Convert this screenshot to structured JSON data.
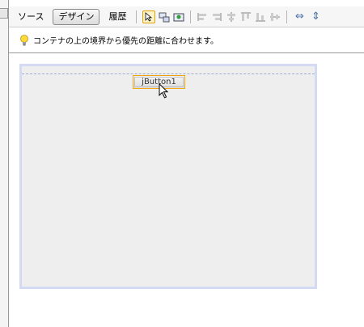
{
  "toolbar": {
    "source_tab": "ソース",
    "design_tab": "デザイン",
    "history_tab": "履歴",
    "icons": [
      "selection-mode-icon",
      "connection-mode-icon",
      "preview-design-icon",
      "align-left-icon",
      "align-right-icon",
      "center-horizontal-icon",
      "align-top-icon",
      "align-bottom-icon",
      "center-vertical-icon",
      "resize-horizontal-icon",
      "resize-vertical-icon"
    ]
  },
  "hint": {
    "text": "コンテナの上の境界から優先の距離に合わせます。"
  },
  "form": {
    "button_label": "jButton1"
  },
  "colors": {
    "selection_border": "#f0a30a",
    "form_border": "#d4d9f4",
    "guide_line": "#9db0d0"
  }
}
